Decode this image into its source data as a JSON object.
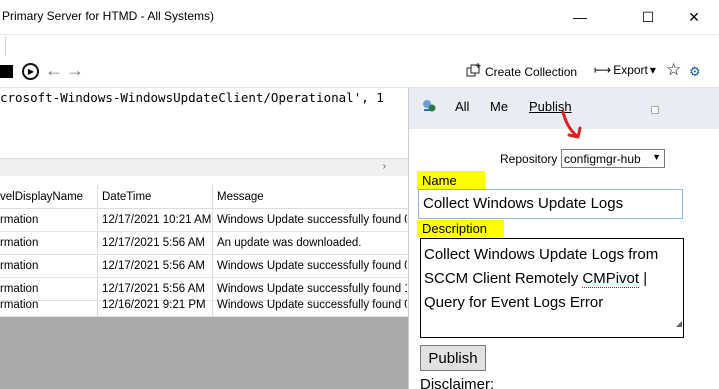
{
  "window": {
    "title": "Primary Server for HTMD - All Systems)",
    "min_glyph": "—",
    "max_glyph": "☐",
    "close_glyph": "✕"
  },
  "toolbar": {
    "run_icon": "▶",
    "back_icon": "←",
    "forward_icon": "→",
    "create_collection_label": "Create Collection",
    "export_label": "Export",
    "export_prefix": "⟼",
    "export_chevron": "▾",
    "star_icon": "☆",
    "extra_icon": "⚙"
  },
  "query": {
    "text": "crosoft-Windows-WindowsUpdateClient/Operational', 1"
  },
  "grid": {
    "columns": [
      "velDisplayName",
      "DateTime",
      "Message"
    ],
    "rows": [
      {
        "level": "rmation",
        "datetime": "12/17/2021 10:21 AM",
        "message": "Windows Update successfully found 0 u"
      },
      {
        "level": "rmation",
        "datetime": "12/17/2021 5:56 AM",
        "message": "An update was downloaded."
      },
      {
        "level": "rmation",
        "datetime": "12/17/2021 5:56 AM",
        "message": "Windows Update successfully found 0 u"
      },
      {
        "level": "rmation",
        "datetime": "12/17/2021 5:56 AM",
        "message": "Windows Update successfully found 1 u"
      },
      {
        "level": "rmation",
        "datetime": "12/16/2021 9:21 PM",
        "message": "Windows Update successfully found 0 u"
      }
    ],
    "scroll_arrow": "›"
  },
  "flyout": {
    "tabs": [
      "All",
      "Me",
      "Publish"
    ],
    "repository_label": "Repository",
    "repository_value": "configmgr-hub",
    "name_label": "Name",
    "name_value": "Collect Windows Update Logs",
    "description_label": "Description",
    "description_line1": "Collect Windows Update Logs from",
    "description_line2_a": "SCCM Client Remotely ",
    "description_line2_b": "CMPivot",
    "description_line3": "Query for Event Logs Error",
    "publish_button": "Publish",
    "disclaimer_label": "Disclaimer:",
    "highlight_color": "#ffff00",
    "annotation_arrow_color": "#e02020"
  }
}
